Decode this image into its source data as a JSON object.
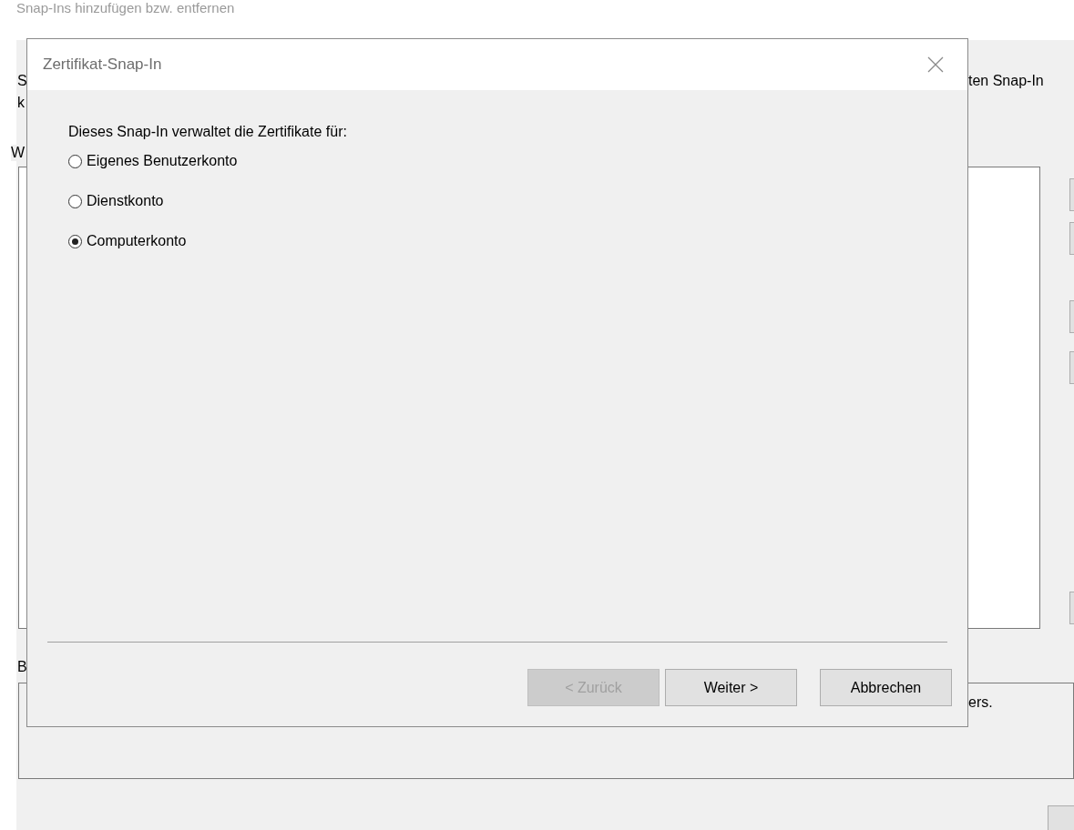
{
  "background_window": {
    "title": "Snap-Ins hinzufügen bzw. entfernen",
    "fragments": [
      {
        "kind": "left",
        "text": "S"
      },
      {
        "kind": "right",
        "text": "ten Snap-In"
      },
      {
        "kind": "left",
        "text": "k"
      },
      {
        "kind": "left",
        "text": "W"
      },
      {
        "kind": "left",
        "text": "B"
      },
      {
        "kind": "right",
        "text": "ers."
      }
    ]
  },
  "dialog": {
    "title": "Zertifikat-Snap-In",
    "prompt": "Dieses Snap-In verwaltet die Zertifikate für:",
    "options": [
      {
        "label": "Eigenes Benutzerkonto",
        "selected": false
      },
      {
        "label": "Dienstkonto",
        "selected": false
      },
      {
        "label": "Computerkonto",
        "selected": true
      }
    ],
    "buttons": [
      {
        "label": "< Zurück",
        "disabled": true
      },
      {
        "label": "Weiter >",
        "disabled": false
      },
      {
        "label": "Abbrechen",
        "disabled": false
      }
    ]
  }
}
